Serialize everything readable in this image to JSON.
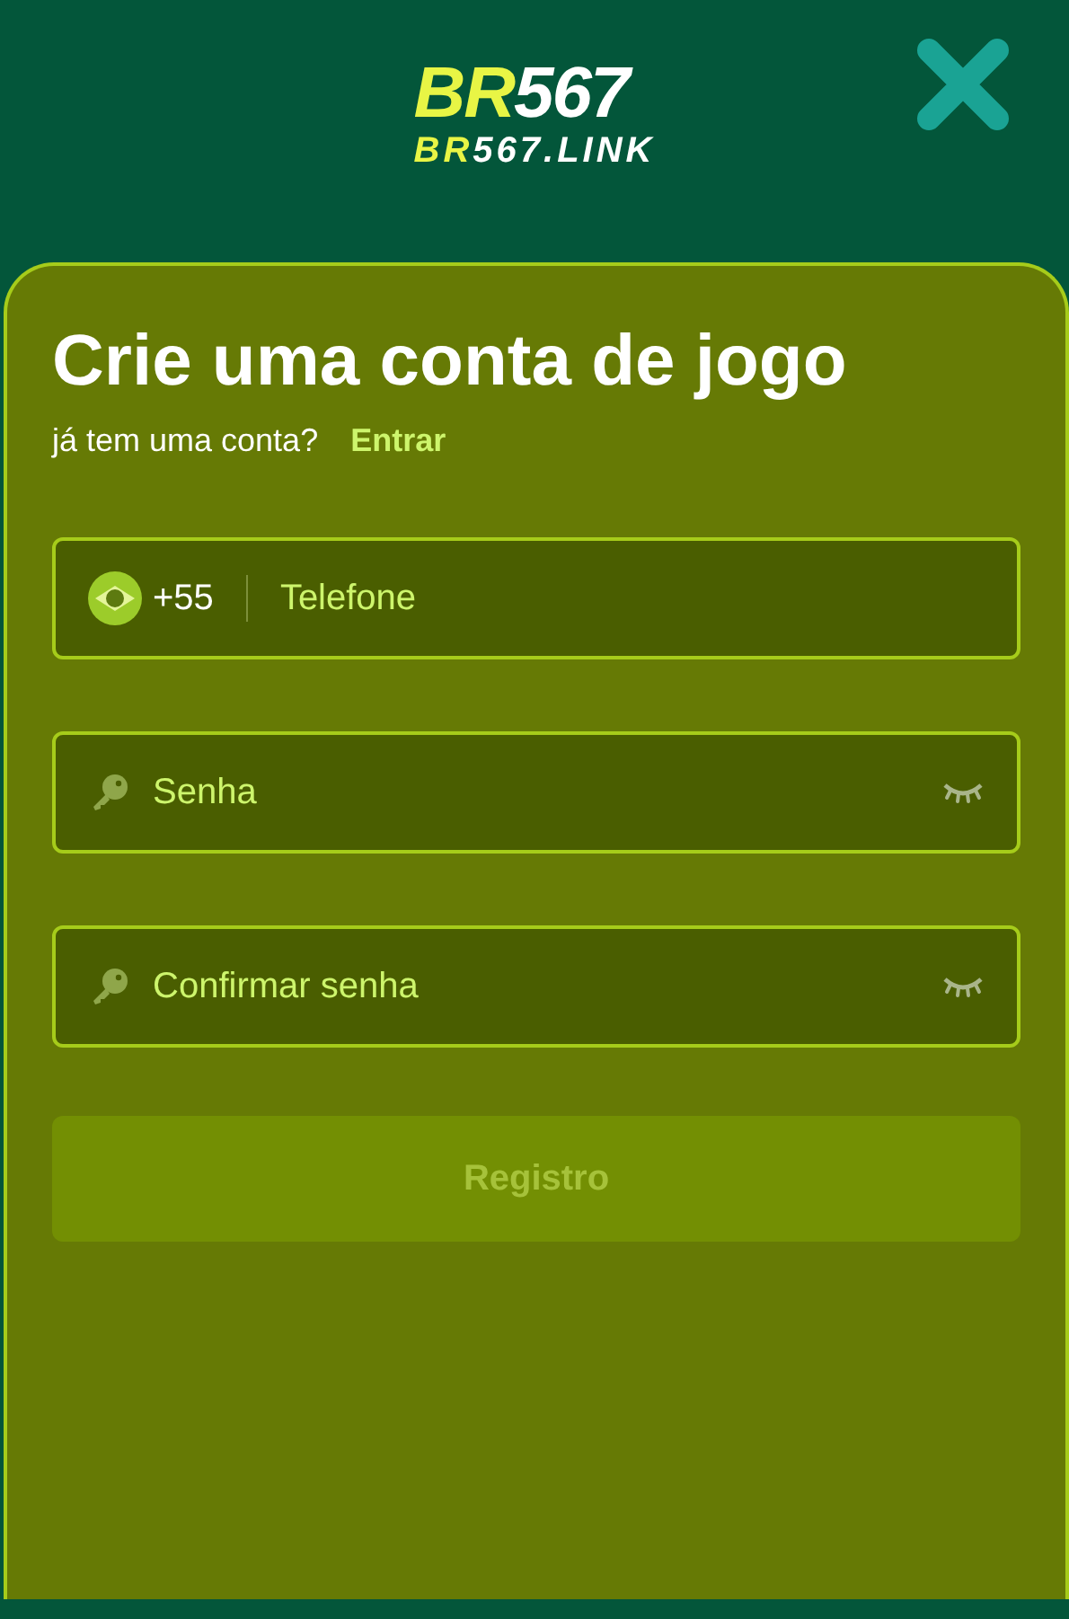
{
  "logo": {
    "brand": "BR",
    "number": "567",
    "sub_brand": "BR",
    "sub_rest": "567.LINK"
  },
  "title": "Crie uma conta de jogo",
  "login_prompt": {
    "text": "já tem uma conta?",
    "link": "Entrar"
  },
  "fields": [
    {
      "kind": "phone",
      "prefix": "+55",
      "placeholder": "Telefone"
    },
    {
      "kind": "password",
      "placeholder": "Senha"
    },
    {
      "kind": "password",
      "placeholder": "Confirmar senha"
    }
  ],
  "submit": {
    "label": "Registro",
    "disabled": true
  }
}
